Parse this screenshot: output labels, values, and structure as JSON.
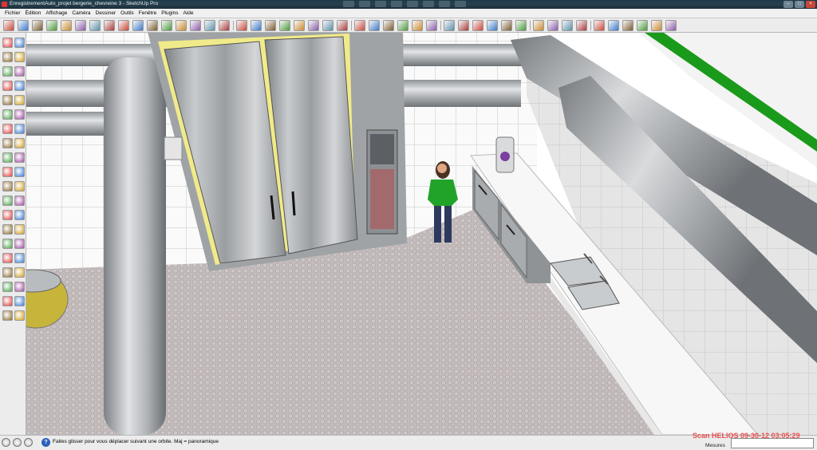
{
  "window": {
    "title": "EnregistrementAuto_projet bergerie_chevreine 3 - SketchUp Pro"
  },
  "menu": [
    "Fichier",
    "Édition",
    "Affichage",
    "Caméra",
    "Dessiner",
    "Outils",
    "Fenêtre",
    "Plugins",
    "Aide"
  ],
  "toolbar": {
    "icons": [
      "select-icon",
      "pencil-icon",
      "rectangle-icon",
      "circle-icon",
      "arc-icon",
      "eraser-icon",
      "paint-bucket-icon",
      "push-pull-icon",
      "follow-me-icon",
      "rotate-icon",
      "offset-icon",
      "tape-measure-icon",
      "dimension-icon",
      "protractor-icon",
      "text-icon",
      "axes-icon",
      "orbit-icon",
      "pan-icon",
      "zoom-icon",
      "zoom-window-icon",
      "zoom-extents-icon",
      "position-camera-icon",
      "walk-icon",
      "look-around-icon",
      "iso-view-icon",
      "top-view-icon",
      "front-view-icon",
      "right-view-icon",
      "back-view-icon",
      "left-view-icon",
      "xray-icon",
      "wireframe-icon",
      "hidden-line-icon",
      "shaded-icon",
      "textured-icon",
      "monochrome-icon",
      "shadows-icon",
      "fog-icon",
      "section-plane-icon",
      "section-cut-icon",
      "model-info-icon",
      "entity-info-icon",
      "materials-icon",
      "components-icon",
      "layers-icon",
      "scenes-icon"
    ]
  },
  "palette": {
    "icons": [
      "select-icon",
      "component-icon",
      "paint-icon",
      "eraser-icon",
      "rectangle-icon",
      "line-icon",
      "circle-icon",
      "arc-icon",
      "polygon-icon",
      "freehand-icon",
      "move-icon",
      "push-pull-icon",
      "rotate-icon",
      "follow-me-icon",
      "scale-icon",
      "offset-icon",
      "tape-icon",
      "dimension-icon",
      "protractor-icon",
      "text-icon",
      "axes-icon",
      "3d-text-icon",
      "orbit-icon",
      "pan-icon",
      "zoom-icon",
      "zoom-window-icon",
      "previous-icon",
      "zoom-extents-icon",
      "position-camera-icon",
      "walk-icon",
      "look-around-icon",
      "section-icon",
      "sandbox-icon",
      "smoove-icon",
      "stamp-icon",
      "drape-icon",
      "add-detail-icon",
      "flip-edge-icon",
      "terrain-icon",
      "contours-icon"
    ]
  },
  "status": {
    "hint": "Faites glisser pour vous déplacer suivant une orbite.  Maj = panoramique",
    "measures_label": "Mesures",
    "measures_value": ""
  },
  "overlay": {
    "watermark": "Scan HELIOS 09-30-12 03:05:29"
  },
  "colors": {
    "title_bar": "#1d3a4a",
    "door_frame": "#f0ea8a",
    "shirt": "#21a32a",
    "grass": "#1a9a1a",
    "watermark": "#ee3333"
  }
}
